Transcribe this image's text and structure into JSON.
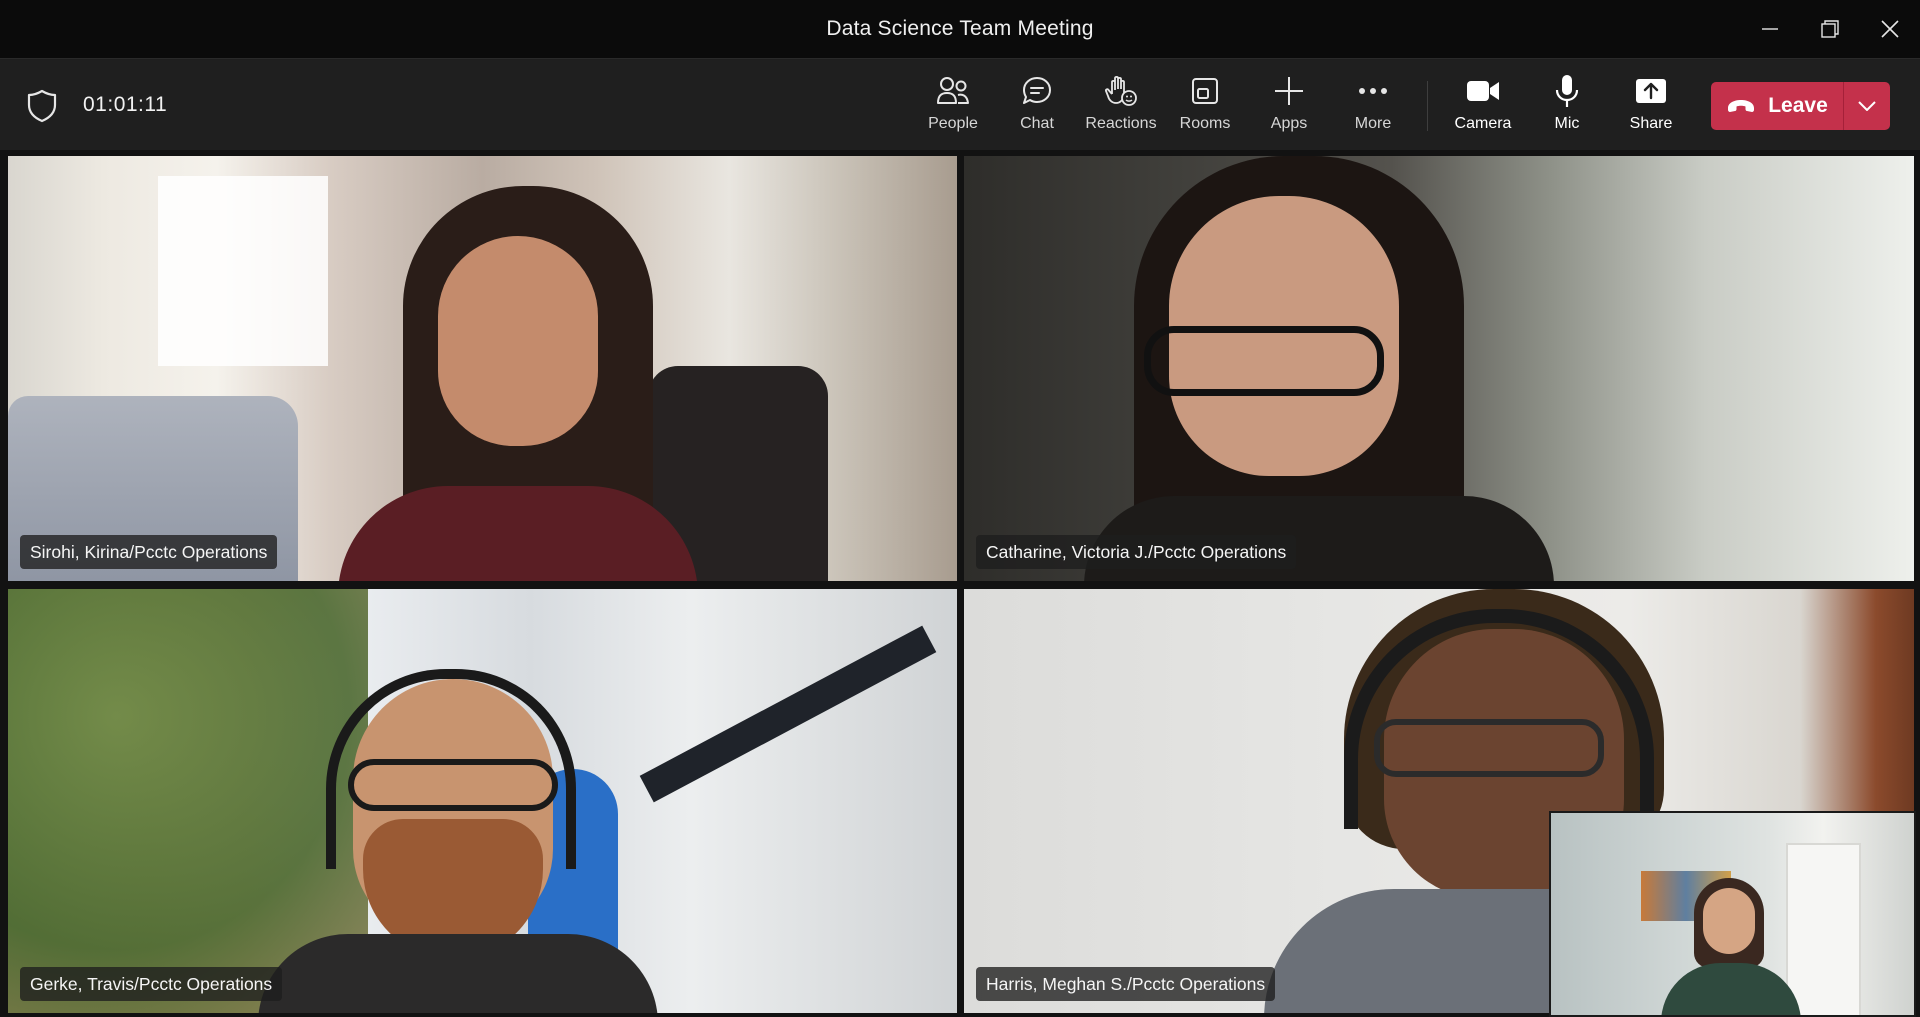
{
  "window": {
    "title": "Data Science Team Meeting",
    "controls": [
      "minimize",
      "restore",
      "close"
    ]
  },
  "toolbar": {
    "timer": "01:01:11",
    "items": [
      {
        "label": "People",
        "icon": "people-icon"
      },
      {
        "label": "Chat",
        "icon": "chat-icon"
      },
      {
        "label": "Reactions",
        "icon": "raised-hand-icon"
      },
      {
        "label": "Rooms",
        "icon": "rooms-icon"
      },
      {
        "label": "Apps",
        "icon": "plus-icon"
      },
      {
        "label": "More",
        "icon": "more-icon"
      }
    ],
    "media": [
      {
        "label": "Camera",
        "icon": "camera-icon"
      },
      {
        "label": "Mic",
        "icon": "microphone-icon"
      },
      {
        "label": "Share",
        "icon": "share-icon"
      }
    ],
    "leave_label": "Leave"
  },
  "participants": [
    {
      "name": "Sirohi, Kirina/Pcctc Operations",
      "speaking": false
    },
    {
      "name": "Catharine, Victoria J./Pcctc Operations",
      "speaking": false
    },
    {
      "name": "Gerke, Travis/Pcctc Operations",
      "speaking": true
    },
    {
      "name": "Harris, Meghan S./Pcctc Operations",
      "speaking": false
    }
  ],
  "colors": {
    "leave": "#c4314b",
    "speaking_outline": "#8f93f5",
    "toolbar_bg": "#1f1f1f",
    "titlebar_bg": "#0b0b0b"
  }
}
